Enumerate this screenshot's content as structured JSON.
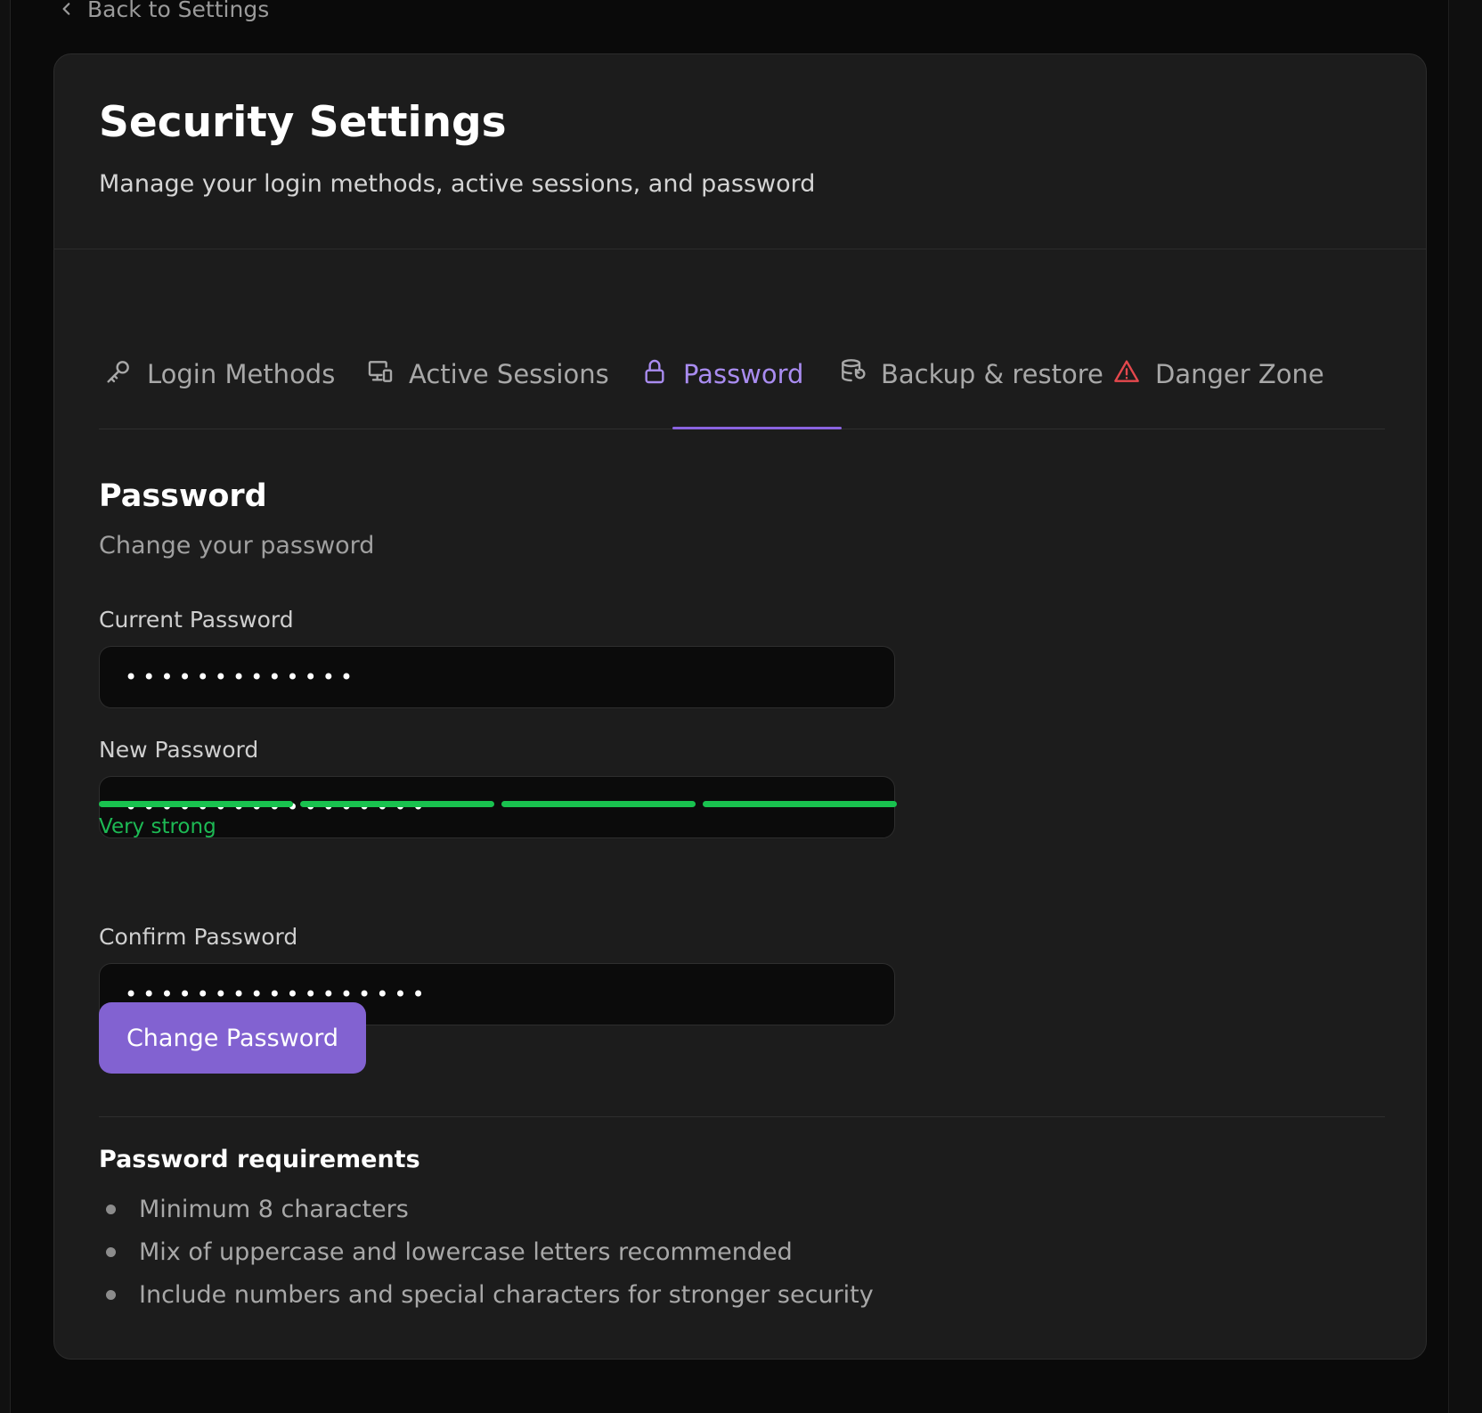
{
  "nav": {
    "back_label": "Back to Settings"
  },
  "header": {
    "title": "Security Settings",
    "subtitle": "Manage your login methods, active sessions, and password"
  },
  "tabs": [
    {
      "label": "Login Methods",
      "icon": "key-icon",
      "active": false
    },
    {
      "label": "Active Sessions",
      "icon": "devices-icon",
      "active": false
    },
    {
      "label": "Password",
      "icon": "lock-icon",
      "active": true
    },
    {
      "label": "Backup & restore",
      "icon": "database-restore-icon",
      "active": false
    },
    {
      "label": "Danger Zone",
      "icon": "warning-triangle-icon",
      "active": false
    }
  ],
  "password_section": {
    "title": "Password",
    "subtitle": "Change your password",
    "current": {
      "label": "Current Password",
      "value": "•••••••••••••"
    },
    "new": {
      "label": "New Password",
      "value": "•••••••••••••••••"
    },
    "strength": {
      "label": "Very strong",
      "filled_segments": 4,
      "total_segments": 4,
      "color": "#19c24f"
    },
    "confirm": {
      "label": "Confirm Password",
      "value": "•••••••••••••••••"
    },
    "submit_label": "Change Password"
  },
  "requirements": {
    "title": "Password requirements",
    "items": [
      "Minimum 8 characters",
      "Mix of uppercase and lowercase letters recommended",
      "Include numbers and special characters for stronger security"
    ]
  },
  "colors": {
    "accent": "#8262d1",
    "accent_text": "#a98cf0",
    "danger": "#e5484d",
    "success": "#19c24f",
    "background": "#0a0a0a",
    "card": "#1c1c1c"
  }
}
